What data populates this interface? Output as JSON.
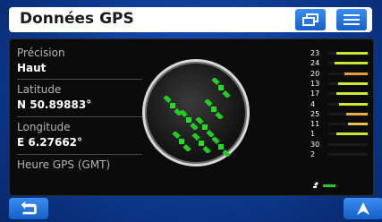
{
  "header": {
    "title": "Données GPS",
    "windows_icon": "windows-icon",
    "menu_icon": "menu-icon"
  },
  "info": {
    "precision_label": "Précision",
    "precision_value": "Haut",
    "latitude_label": "Latitude",
    "latitude_value": "N 50.89883°",
    "longitude_label": "Longitude",
    "longitude_value": "E 6.27662°",
    "gps_time_label": "Heure GPS (GMT)"
  },
  "satellite_bars": [
    {
      "id": "23",
      "level": 0.8,
      "color": "#c8e830"
    },
    {
      "id": "24",
      "level": 0.85,
      "color": "#c8e830"
    },
    {
      "id": "20",
      "level": 0.6,
      "color": "#e8a030"
    },
    {
      "id": "13",
      "level": 0.75,
      "color": "#d0e830"
    },
    {
      "id": "17",
      "level": 0.8,
      "color": "#d0e830"
    },
    {
      "id": "4",
      "level": 0.72,
      "color": "#d0e830"
    },
    {
      "id": "25",
      "level": 0.55,
      "color": "#e8b040"
    },
    {
      "id": "11",
      "level": 0.5,
      "color": "#e8c040"
    },
    {
      "id": "1",
      "level": 0.8,
      "color": "#c8e830"
    },
    {
      "id": "30",
      "level": 0.0,
      "color": "#555555"
    },
    {
      "id": "2",
      "level": 0.0,
      "color": "#555555"
    }
  ],
  "colors": {
    "accent": "#1e6fdc",
    "background": "#0d3a8c",
    "satellite": "#22cc22"
  },
  "footer": {
    "back_icon": "back-arrow-icon",
    "navigate_icon": "navigate-arrow-icon"
  }
}
